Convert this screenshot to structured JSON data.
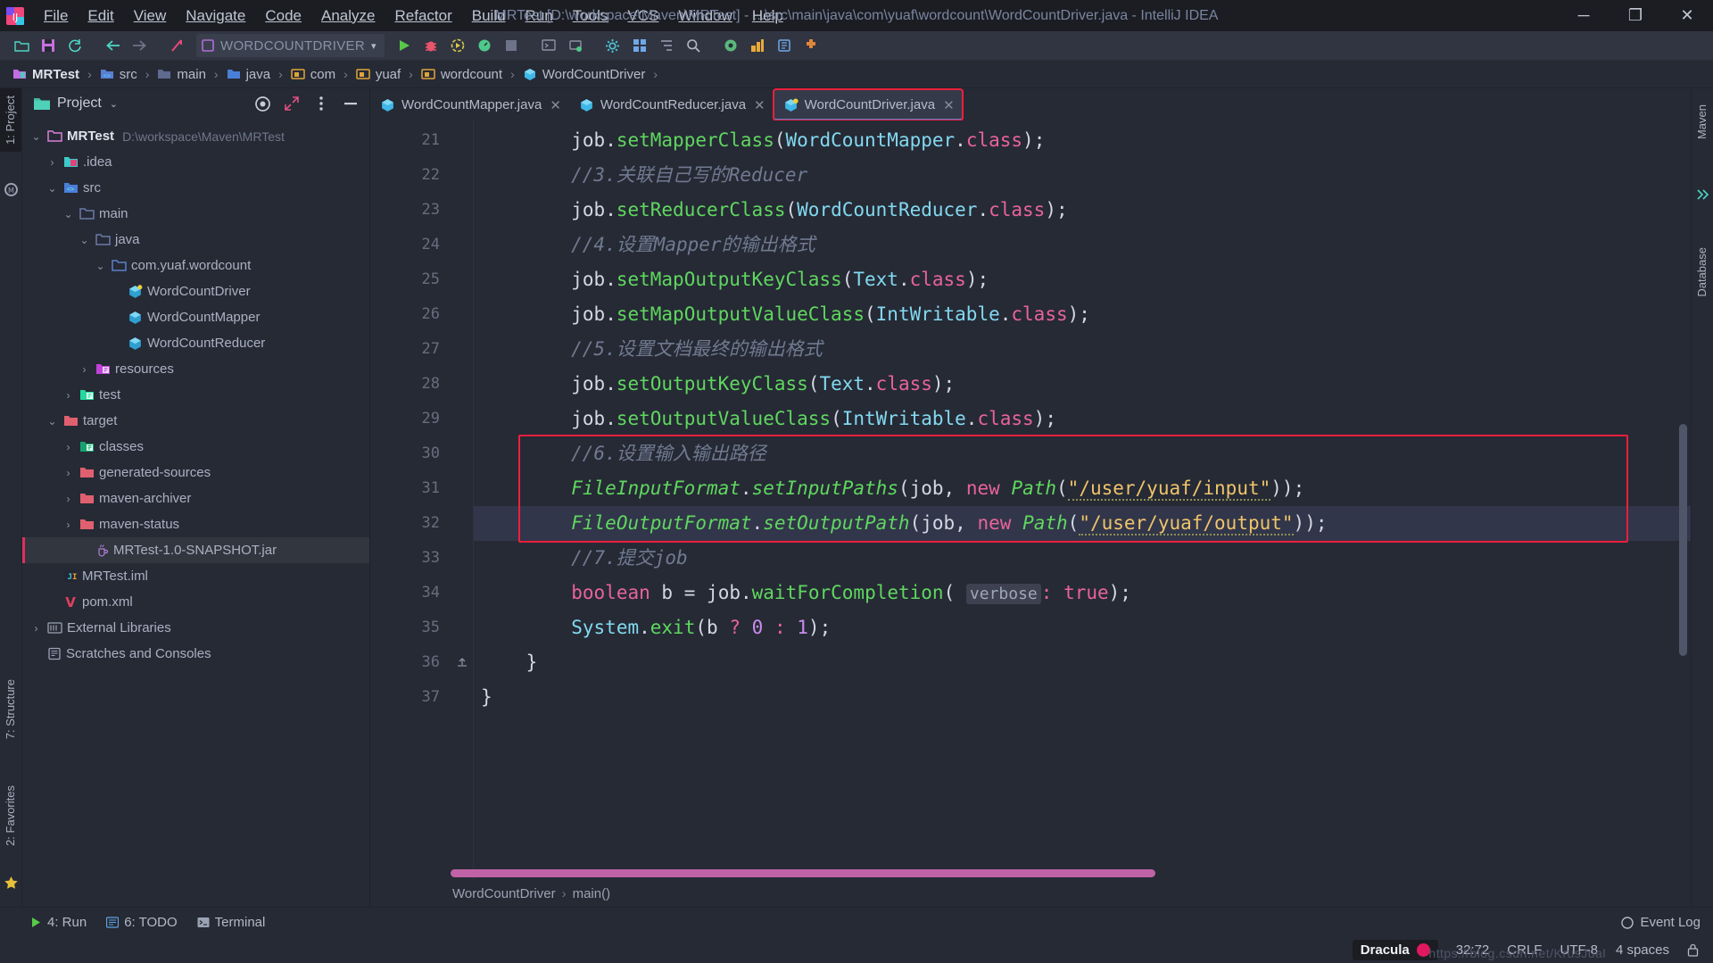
{
  "window": {
    "title": "MRTest [D:\\workspace\\Maven\\MRTest] - ...\\src\\main\\java\\com\\yuaf\\wordcount\\WordCountDriver.java - IntelliJ IDEA",
    "minimize_label": "─",
    "maximize_label": "❐",
    "close_label": "✕"
  },
  "menu": [
    {
      "label": "File"
    },
    {
      "label": "Edit"
    },
    {
      "label": "View"
    },
    {
      "label": "Navigate"
    },
    {
      "label": "Code"
    },
    {
      "label": "Analyze"
    },
    {
      "label": "Refactor"
    },
    {
      "label": "Build"
    },
    {
      "label": "Run"
    },
    {
      "label": "Tools"
    },
    {
      "label": "VCS"
    },
    {
      "label": "Window"
    },
    {
      "label": "Help"
    }
  ],
  "toolbar": {
    "run_config": "WORDCOUNTDRIVER",
    "run_config_caret": "▾",
    "icons": [
      "open-folder-icon",
      "save-all-icon",
      "sync-icon",
      "back-arrow-icon",
      "forward-arrow-icon",
      "open-in-browser-icon",
      "run-icon",
      "debug-icon",
      "run-with-coverage-icon",
      "profile-icon",
      "stop-icon",
      "run-dashboard-icon",
      "attach-debugger-icon",
      "settings-gear-icon",
      "layout-grid-icon",
      "structure-icon",
      "search-icon",
      "inspect-icon",
      "update-icon",
      "bookmark-icon",
      "plugin-icon"
    ]
  },
  "breadcrumb": [
    {
      "label": "MRTest",
      "icon": "module-icon"
    },
    {
      "label": "src",
      "icon": "source-folder-icon"
    },
    {
      "label": "main",
      "icon": "folder-icon"
    },
    {
      "label": "java",
      "icon": "source-root-icon"
    },
    {
      "label": "com",
      "icon": "package-icon"
    },
    {
      "label": "yuaf",
      "icon": "package-icon"
    },
    {
      "label": "wordcount",
      "icon": "package-icon"
    },
    {
      "label": "WordCountDriver",
      "icon": "java-class-icon"
    }
  ],
  "left_rail": [
    {
      "label": "1: Project",
      "active": true
    },
    {
      "label": "2: Favorites",
      "active": false
    },
    {
      "label": "7: Structure",
      "active": false
    }
  ],
  "right_rail": [
    {
      "label": "Maven"
    },
    {
      "label": "Database"
    }
  ],
  "project_panel": {
    "title": "Project",
    "title_caret": "⌄",
    "actions": [
      "locate-target-icon",
      "collapse-all-icon",
      "more-options-icon",
      "hide-panel-icon"
    ],
    "tree": [
      {
        "label": "MRTest",
        "path": "D:\\workspace\\Maven\\MRTest",
        "depth": 0,
        "arrow": "⌄",
        "icon": "project-folder-icon",
        "bold": true,
        "selected": false
      },
      {
        "label": ".idea",
        "path": "",
        "depth": 1,
        "arrow": "›",
        "icon": "idea-folder-icon",
        "bold": false,
        "selected": false
      },
      {
        "label": "src",
        "path": "",
        "depth": 1,
        "arrow": "⌄",
        "icon": "source-folder-icon",
        "bold": false,
        "selected": false
      },
      {
        "label": "main",
        "path": "",
        "depth": 2,
        "arrow": "⌄",
        "icon": "folder-icon",
        "bold": false,
        "selected": false
      },
      {
        "label": "java",
        "path": "",
        "depth": 3,
        "arrow": "⌄",
        "icon": "folder-icon",
        "bold": false,
        "selected": false
      },
      {
        "label": "com.yuaf.wordcount",
        "path": "",
        "depth": 4,
        "arrow": "⌄",
        "icon": "package-icon",
        "bold": false,
        "selected": false
      },
      {
        "label": "WordCountDriver",
        "path": "",
        "depth": 5,
        "arrow": "",
        "icon": "java-class-main-icon",
        "bold": false,
        "selected": false
      },
      {
        "label": "WordCountMapper",
        "path": "",
        "depth": 5,
        "arrow": "",
        "icon": "java-class-icon",
        "bold": false,
        "selected": false
      },
      {
        "label": "WordCountReducer",
        "path": "",
        "depth": 5,
        "arrow": "",
        "icon": "java-class-icon",
        "bold": false,
        "selected": false
      },
      {
        "label": "resources",
        "path": "",
        "depth": 3,
        "arrow": "›",
        "icon": "resources-folder-icon",
        "bold": false,
        "selected": false
      },
      {
        "label": "test",
        "path": "",
        "depth": 2,
        "arrow": "›",
        "icon": "test-folder-icon",
        "bold": false,
        "selected": false
      },
      {
        "label": "target",
        "path": "",
        "depth": 1,
        "arrow": "⌄",
        "icon": "excluded-folder-icon",
        "bold": false,
        "selected": false
      },
      {
        "label": "classes",
        "path": "",
        "depth": 2,
        "arrow": "›",
        "icon": "classes-folder-icon",
        "bold": false,
        "selected": false
      },
      {
        "label": "generated-sources",
        "path": "",
        "depth": 2,
        "arrow": "›",
        "icon": "excluded-folder-icon",
        "bold": false,
        "selected": false
      },
      {
        "label": "maven-archiver",
        "path": "",
        "depth": 2,
        "arrow": "›",
        "icon": "excluded-folder-icon",
        "bold": false,
        "selected": false
      },
      {
        "label": "maven-status",
        "path": "",
        "depth": 2,
        "arrow": "›",
        "icon": "excluded-folder-icon",
        "bold": false,
        "selected": false
      },
      {
        "label": "MRTest-1.0-SNAPSHOT.jar",
        "path": "",
        "depth": 3,
        "arrow": "",
        "icon": "jar-icon",
        "bold": false,
        "selected": true
      },
      {
        "label": "MRTest.iml",
        "path": "",
        "depth": 1,
        "arrow": "",
        "icon": "iml-icon",
        "bold": false,
        "selected": false
      },
      {
        "label": "pom.xml",
        "path": "",
        "depth": 1,
        "arrow": "",
        "icon": "maven-icon",
        "bold": false,
        "selected": false
      },
      {
        "label": "External Libraries",
        "path": "",
        "depth": 0,
        "arrow": "›",
        "icon": "library-icon",
        "bold": false,
        "selected": false
      },
      {
        "label": "Scratches and Consoles",
        "path": "",
        "depth": 0,
        "arrow": "",
        "icon": "scratches-icon",
        "bold": false,
        "selected": false
      }
    ]
  },
  "editor_tabs": [
    {
      "label": "WordCountMapper.java",
      "active": false,
      "boxed": false,
      "close": "✕"
    },
    {
      "label": "WordCountReducer.java",
      "active": false,
      "boxed": false,
      "close": "✕"
    },
    {
      "label": "WordCountDriver.java",
      "active": true,
      "boxed": true,
      "close": "✕"
    }
  ],
  "code": {
    "first_line_number": 21,
    "lines": [
      {
        "n": 21,
        "text": "        job.setMapperClass(WordCountMapper.class);"
      },
      {
        "n": 22,
        "text": "        //3.关联自己写的Reducer"
      },
      {
        "n": 23,
        "text": "        job.setReducerClass(WordCountReducer.class);"
      },
      {
        "n": 24,
        "text": "        //4.设置Mapper的输出格式"
      },
      {
        "n": 25,
        "text": "        job.setMapOutputKeyClass(Text.class);"
      },
      {
        "n": 26,
        "text": "        job.setMapOutputValueClass(IntWritable.class);"
      },
      {
        "n": 27,
        "text": "        //5.设置文档最终的输出格式"
      },
      {
        "n": 28,
        "text": "        job.setOutputKeyClass(Text.class);"
      },
      {
        "n": 29,
        "text": "        job.setOutputValueClass(IntWritable.class);"
      },
      {
        "n": 30,
        "text": "        //6.设置输入输出路径"
      },
      {
        "n": 31,
        "text": "        FileInputFormat.setInputPaths(job, new Path(\"/user/yuaf/input\"));"
      },
      {
        "n": 32,
        "text": "        FileOutputFormat.setOutputPath(job, new Path(\"/user/yuaf/output\"));"
      },
      {
        "n": 33,
        "text": "        //7.提交job"
      },
      {
        "n": 34,
        "text": "        boolean b = job.waitForCompletion( verbose: true);"
      },
      {
        "n": 35,
        "text": "        System.exit(b ? 0 : 1);"
      },
      {
        "n": 36,
        "text": "    }"
      },
      {
        "n": 37,
        "text": "}"
      }
    ],
    "current_line": 32,
    "inlay_hint": "verbose:",
    "path_input": "/user/yuaf/input",
    "path_output": "/user/yuaf/output"
  },
  "editor_breadcrumb": [
    {
      "label": "WordCountDriver"
    },
    {
      "label": "main()"
    }
  ],
  "bottom_tools": [
    {
      "label": "4: Run",
      "icon": "run-icon"
    },
    {
      "label": "6: TODO",
      "icon": "todo-icon"
    },
    {
      "label": "Terminal",
      "icon": "terminal-icon"
    }
  ],
  "event_log": {
    "label": "Event Log",
    "icon": "event-log-icon"
  },
  "status": {
    "theme": "Dracula",
    "caret_position": "32:72",
    "line_separator": "CRLF",
    "encoding": "UTF-8",
    "indent": "4 spaces",
    "lock_icon": "lock-icon",
    "watermark": "https://blog.csdn.net/KrusJual"
  },
  "colors": {
    "accent_red": "#ee1f3c",
    "background": "#262a35",
    "titlebar": "#1b1d23",
    "selection": "#32363f",
    "theme_dot": "#e0195e",
    "method_green": "#5fd75f",
    "type_cyan": "#82d9f0",
    "keyword_pink": "#e8639b",
    "string_yellow": "#efc46a",
    "comment_gray": "#707a90"
  }
}
